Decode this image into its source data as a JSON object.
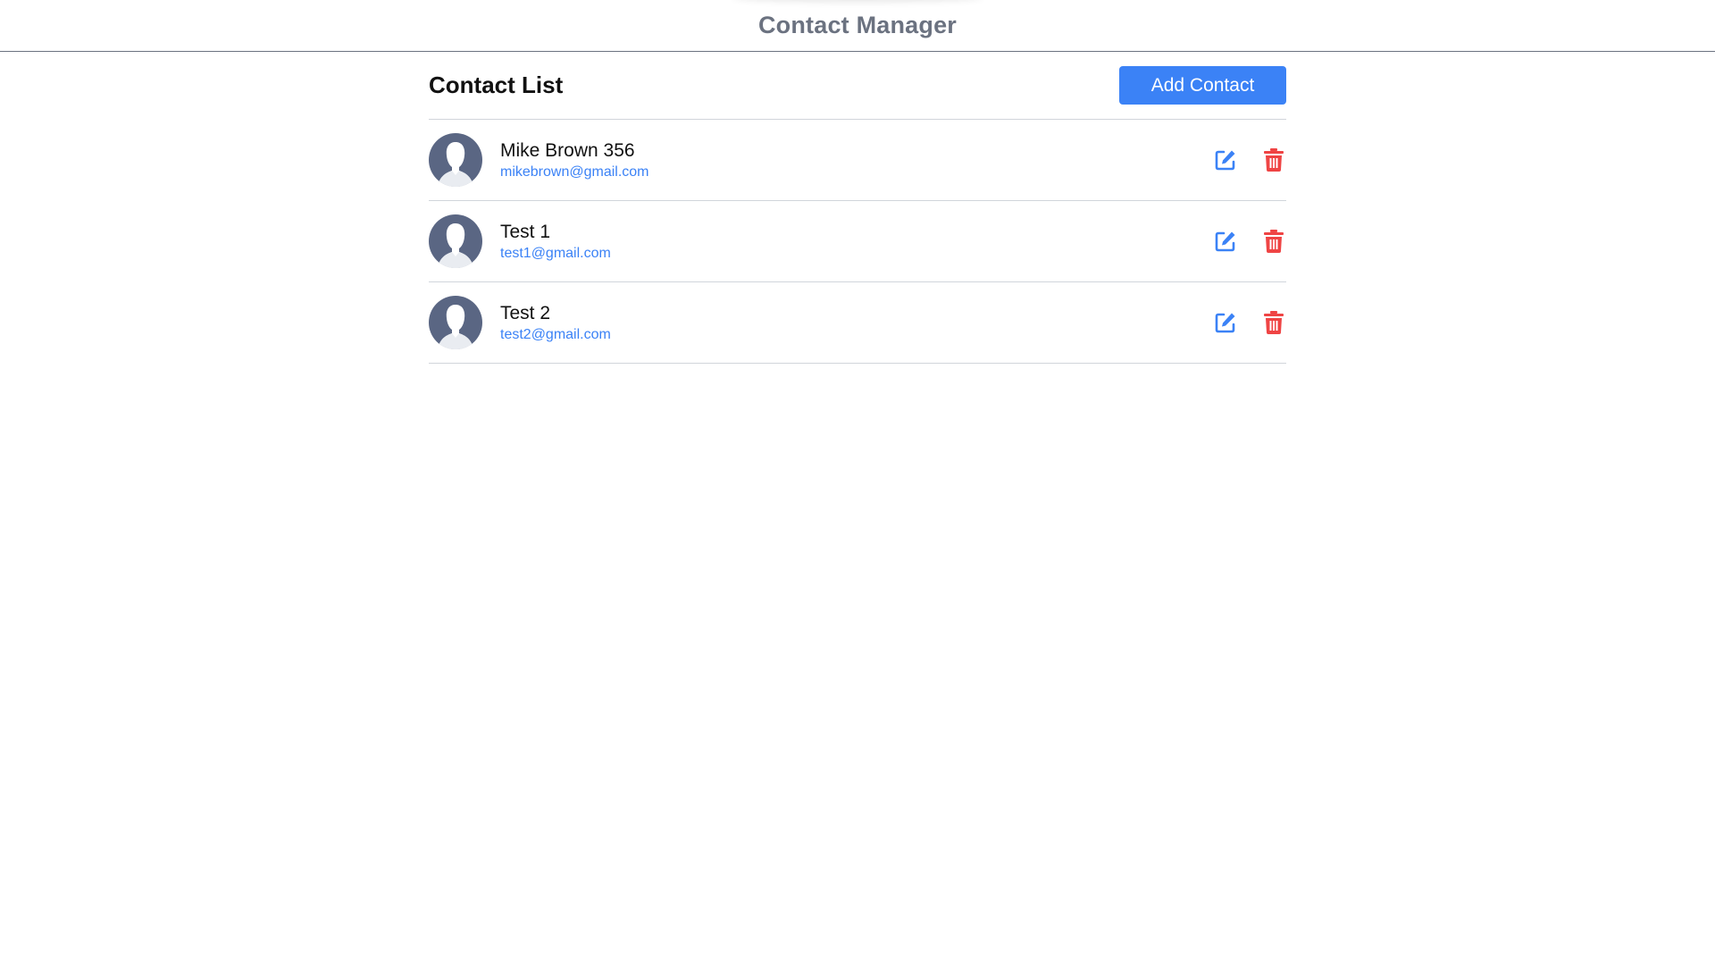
{
  "header": {
    "title": "Contact Manager"
  },
  "list": {
    "title": "Contact List",
    "add_button_label": "Add Contact"
  },
  "contacts": [
    {
      "name": "Mike Brown 356",
      "email": "mikebrown@gmail.com"
    },
    {
      "name": "Test 1",
      "email": "test1@gmail.com"
    },
    {
      "name": "Test 2",
      "email": "test2@gmail.com"
    }
  ],
  "colors": {
    "accent": "#3b82f6",
    "danger": "#ef4444",
    "avatar_bg": "#5a6683",
    "title_gray": "#6b7280"
  },
  "icons": {
    "edit": "edit-icon",
    "delete": "trash-icon",
    "avatar": "user-silhouette-icon"
  }
}
